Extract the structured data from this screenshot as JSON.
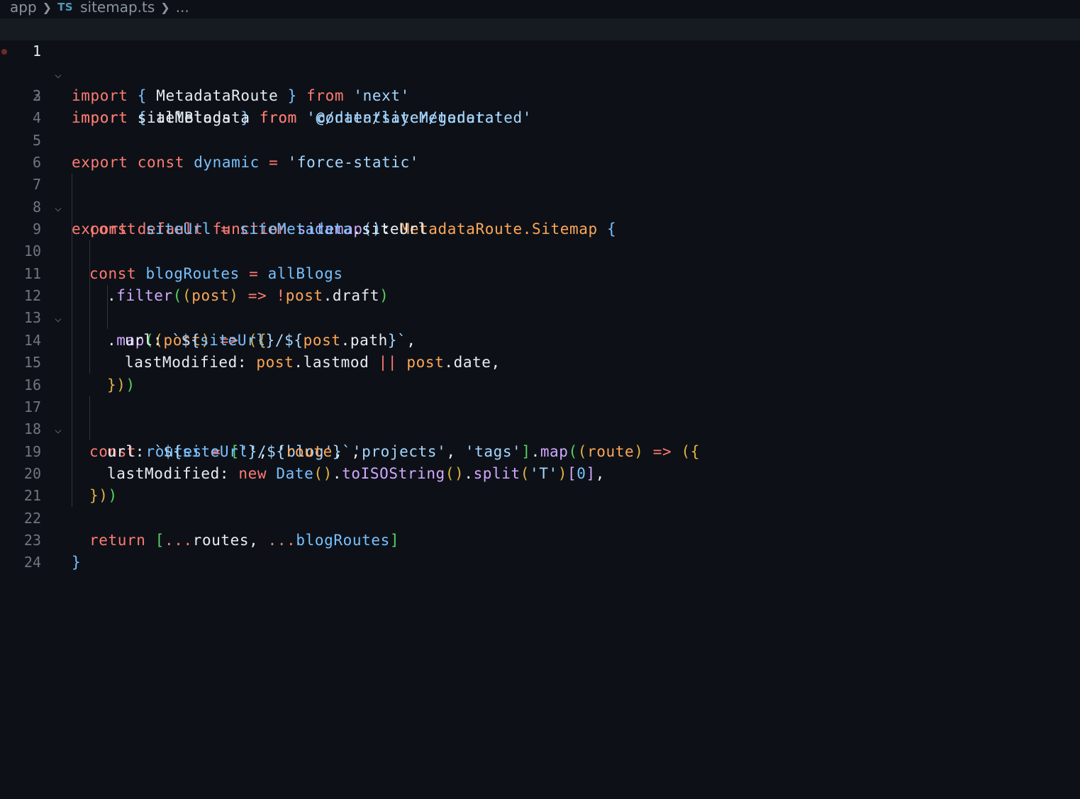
{
  "breadcrumb": {
    "folder": "app",
    "file_icon": "TS",
    "file_name": "sitemap.ts",
    "more": "..."
  },
  "editor": {
    "current_line": 1,
    "lines": [
      {
        "n": "1"
      },
      {
        "n": "2"
      },
      {
        "n": "3"
      },
      {
        "n": "4"
      },
      {
        "n": "5"
      },
      {
        "n": "6"
      },
      {
        "n": "7"
      },
      {
        "n": "8"
      },
      {
        "n": "9"
      },
      {
        "n": "10"
      },
      {
        "n": "11"
      },
      {
        "n": "12"
      },
      {
        "n": "13"
      },
      {
        "n": "14"
      },
      {
        "n": "15"
      },
      {
        "n": "16"
      },
      {
        "n": "17"
      },
      {
        "n": "18"
      },
      {
        "n": "19"
      },
      {
        "n": "20"
      },
      {
        "n": "21"
      },
      {
        "n": "22"
      },
      {
        "n": "23"
      },
      {
        "n": "24"
      }
    ],
    "code": {
      "l1": [
        [
          "kw",
          "import"
        ],
        [
          "pl",
          " "
        ],
        [
          "b1",
          "{"
        ],
        [
          "pl",
          " MetadataRoute "
        ],
        [
          "b1",
          "}"
        ],
        [
          "pl",
          " "
        ],
        [
          "kw",
          "from"
        ],
        [
          "pl",
          " "
        ],
        [
          "str",
          "'next'"
        ]
      ],
      "l2": [
        [
          "kw",
          "import"
        ],
        [
          "pl",
          " "
        ],
        [
          "b1",
          "{"
        ],
        [
          "pl",
          " allBlogs "
        ],
        [
          "b1",
          "}"
        ],
        [
          "pl",
          " "
        ],
        [
          "kw",
          "from"
        ],
        [
          "pl",
          " "
        ],
        [
          "str",
          "'contentlayer/generated'"
        ]
      ],
      "l3": [
        [
          "kw",
          "import"
        ],
        [
          "pl",
          " siteMetadata "
        ],
        [
          "kw",
          "from"
        ],
        [
          "pl",
          " "
        ],
        [
          "str",
          "'@/data/siteMetadata'"
        ]
      ],
      "l4": [],
      "l5": [
        [
          "kw",
          "export"
        ],
        [
          "pl",
          " "
        ],
        [
          "kw",
          "const"
        ],
        [
          "pl",
          " "
        ],
        [
          "v",
          "dynamic"
        ],
        [
          "pl",
          " "
        ],
        [
          "op",
          "="
        ],
        [
          "pl",
          " "
        ],
        [
          "str",
          "'force-static'"
        ]
      ],
      "l6": [],
      "l7": [
        [
          "kw",
          "export"
        ],
        [
          "pl",
          " "
        ],
        [
          "kw",
          "default"
        ],
        [
          "pl",
          " "
        ],
        [
          "kw",
          "function"
        ],
        [
          "pl",
          " "
        ],
        [
          "fn",
          "sitemap"
        ],
        [
          "b1",
          "()"
        ],
        [
          "pl",
          ": "
        ],
        [
          "ty",
          "MetadataRoute.Sitemap"
        ],
        [
          "pl",
          " "
        ],
        [
          "b1",
          "{"
        ]
      ],
      "l8": [
        [
          "kw",
          "const"
        ],
        [
          "pl",
          " "
        ],
        [
          "v",
          "siteUrl"
        ],
        [
          "pl",
          " "
        ],
        [
          "op",
          "="
        ],
        [
          "pl",
          " "
        ],
        [
          "v",
          "siteMetadata"
        ],
        [
          "pl",
          ".siteUrl"
        ]
      ],
      "l9": [],
      "l10": [
        [
          "kw",
          "const"
        ],
        [
          "pl",
          " "
        ],
        [
          "v",
          "blogRoutes"
        ],
        [
          "pl",
          " "
        ],
        [
          "op",
          "="
        ],
        [
          "pl",
          " "
        ],
        [
          "v",
          "allBlogs"
        ]
      ],
      "l11": [
        [
          "pl",
          "."
        ],
        [
          "fn",
          "filter"
        ],
        [
          "b2",
          "("
        ],
        [
          "bY",
          "("
        ],
        [
          "p",
          "post"
        ],
        [
          "bY",
          ")"
        ],
        [
          "pl",
          " "
        ],
        [
          "op",
          "=>"
        ],
        [
          "pl",
          " "
        ],
        [
          "op",
          "!"
        ],
        [
          "p",
          "post"
        ],
        [
          "pl",
          ".draft"
        ],
        [
          "b2",
          ")"
        ]
      ],
      "l12": [
        [
          "pl",
          "."
        ],
        [
          "fn",
          "map"
        ],
        [
          "b2",
          "("
        ],
        [
          "bY",
          "("
        ],
        [
          "p",
          "post"
        ],
        [
          "bY",
          ")"
        ],
        [
          "pl",
          " "
        ],
        [
          "op",
          "=>"
        ],
        [
          "pl",
          " "
        ],
        [
          "bY",
          "({"
        ]
      ],
      "l13": [
        [
          "pl",
          "url: "
        ],
        [
          "str",
          "`${"
        ],
        [
          "v",
          "siteUrl"
        ],
        [
          "str",
          "}/${"
        ],
        [
          "p",
          "post"
        ],
        [
          "pl",
          ".path"
        ],
        [
          "str",
          "}`"
        ],
        [
          "pl",
          ","
        ]
      ],
      "l14": [
        [
          "pl",
          "lastModified: "
        ],
        [
          "p",
          "post"
        ],
        [
          "pl",
          ".lastmod "
        ],
        [
          "op",
          "||"
        ],
        [
          "pl",
          " "
        ],
        [
          "p",
          "post"
        ],
        [
          "pl",
          ".date,"
        ]
      ],
      "l15": [
        [
          "bY",
          "})"
        ],
        [
          "b2",
          ")"
        ]
      ],
      "l16": [],
      "l17": [
        [
          "kw",
          "const"
        ],
        [
          "pl",
          " "
        ],
        [
          "v",
          "routes"
        ],
        [
          "pl",
          " "
        ],
        [
          "op",
          "="
        ],
        [
          "pl",
          " "
        ],
        [
          "b2",
          "["
        ],
        [
          "str",
          "''"
        ],
        [
          "pl",
          ", "
        ],
        [
          "str",
          "'blog'"
        ],
        [
          "pl",
          ", "
        ],
        [
          "str",
          "'projects'"
        ],
        [
          "pl",
          ", "
        ],
        [
          "str",
          "'tags'"
        ],
        [
          "b2",
          "]"
        ],
        [
          "pl",
          "."
        ],
        [
          "fn",
          "map"
        ],
        [
          "b2",
          "("
        ],
        [
          "bY",
          "("
        ],
        [
          "p",
          "route"
        ],
        [
          "bY",
          ")"
        ],
        [
          "pl",
          " "
        ],
        [
          "op",
          "=>"
        ],
        [
          "pl",
          " "
        ],
        [
          "bY",
          "({"
        ]
      ],
      "l18": [
        [
          "pl",
          "url: "
        ],
        [
          "str",
          "`${"
        ],
        [
          "v",
          "siteUrl"
        ],
        [
          "str",
          "}/${"
        ],
        [
          "p",
          "route"
        ],
        [
          "str",
          "}`"
        ],
        [
          "pl",
          ","
        ]
      ],
      "l19": [
        [
          "pl",
          "lastModified: "
        ],
        [
          "kw",
          "new"
        ],
        [
          "pl",
          " "
        ],
        [
          "v",
          "Date"
        ],
        [
          "bY",
          "()"
        ],
        [
          "pl",
          "."
        ],
        [
          "fn",
          "toISOString"
        ],
        [
          "bY",
          "()"
        ],
        [
          "pl",
          "."
        ],
        [
          "fn",
          "split"
        ],
        [
          "bY",
          "("
        ],
        [
          "str",
          "'T'"
        ],
        [
          "bY",
          ")"
        ],
        [
          "fn",
          "["
        ],
        [
          "v",
          "0"
        ],
        [
          "fn",
          "]"
        ],
        [
          "pl",
          ","
        ]
      ],
      "l20": [
        [
          "bY",
          "})"
        ],
        [
          "b2",
          ")"
        ]
      ],
      "l21": [],
      "l22": [
        [
          "kw",
          "return"
        ],
        [
          "pl",
          " "
        ],
        [
          "b2",
          "["
        ],
        [
          "op",
          "..."
        ],
        [
          "pl",
          "routes, "
        ],
        [
          "op",
          "..."
        ],
        [
          "v",
          "blogRoutes"
        ],
        [
          "b2",
          "]"
        ]
      ],
      "l23": [
        [
          "b1",
          "}"
        ]
      ],
      "l24": []
    }
  },
  "colors": {
    "background": "#0d1117",
    "keyword": "#ff7b72",
    "string": "#a5d6ff",
    "function": "#d2a8ff",
    "type": "#ffa657",
    "variable": "#79c0ff",
    "line_number": "#6e7681"
  }
}
